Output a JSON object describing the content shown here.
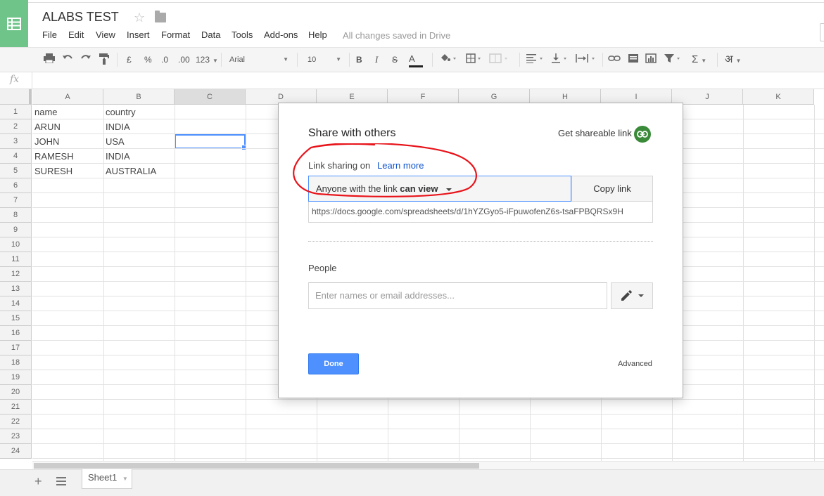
{
  "doc": {
    "title": "ALABS TEST",
    "menu": [
      "File",
      "Edit",
      "View",
      "Insert",
      "Format",
      "Data",
      "Tools",
      "Add-ons",
      "Help"
    ],
    "save_status": "All changes saved in Drive"
  },
  "toolbar": {
    "currency": "£",
    "percent": "%",
    "dec_decrease": ".0",
    "dec_increase": ".00",
    "number_format": "123",
    "font": "Arial",
    "font_size": "10",
    "bold": "B",
    "italic": "I",
    "strike": "S",
    "text_color": "A",
    "sigma": "Σ",
    "input_tools": "अ"
  },
  "formula": {
    "fx": "fx"
  },
  "grid": {
    "columns": [
      "A",
      "B",
      "C",
      "D",
      "E",
      "F",
      "G",
      "H",
      "I",
      "J",
      "K"
    ],
    "rows": [
      "1",
      "2",
      "3",
      "4",
      "5",
      "6",
      "7",
      "8",
      "9",
      "10",
      "11",
      "12",
      "13",
      "14",
      "15",
      "16",
      "17",
      "18",
      "19",
      "20",
      "21",
      "22",
      "23",
      "24"
    ],
    "data": [
      [
        "name",
        "country"
      ],
      [
        "ARUN",
        "INDIA"
      ],
      [
        "JOHN",
        "USA"
      ],
      [
        "RAMESH",
        "INDIA"
      ],
      [
        "SURESH",
        "AUSTRALIA"
      ]
    ]
  },
  "sheets": {
    "add": "+",
    "tabs": [
      "Sheet1"
    ]
  },
  "dialog": {
    "title": "Share with others",
    "get_link": "Get shareable link",
    "link_sharing": "Link sharing on",
    "learn_more": "Learn more",
    "permission_prefix": "Anyone with the link",
    "permission_value": "can view",
    "copy_link": "Copy link",
    "url": "https://docs.google.com/spreadsheets/d/1hYZGyo5-iFpuwofenZ6s-tsaFPBQRSx9H",
    "people_label": "People",
    "people_placeholder": "Enter names or email addresses...",
    "done": "Done",
    "advanced": "Advanced"
  },
  "colors": {
    "brand_green": "#6fc489",
    "primary_blue": "#4d90fe",
    "link_blue": "#1155cc",
    "annotation_red": "#e8141b"
  }
}
